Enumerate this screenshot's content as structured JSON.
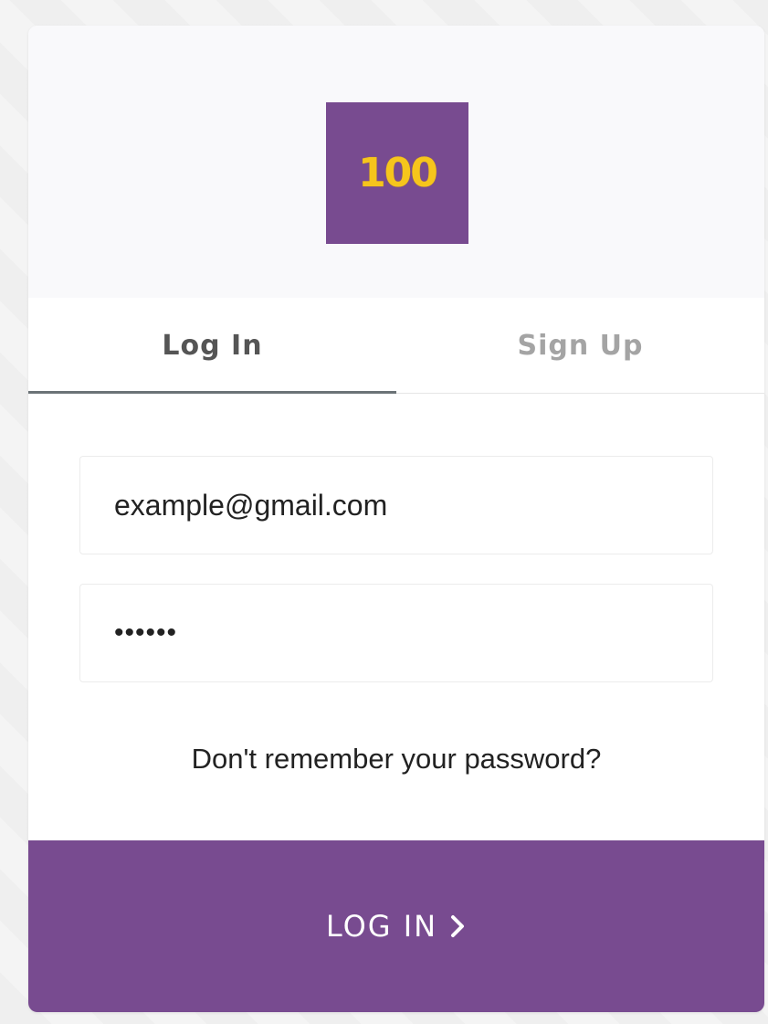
{
  "logo": {
    "text": "100",
    "background_color": "#784b90",
    "text_color": "#f6c51c"
  },
  "tabs": [
    {
      "label": "Log In",
      "active": true
    },
    {
      "label": "Sign Up",
      "active": false
    }
  ],
  "form": {
    "email_value": "example@gmail.com",
    "password_value": "••••••",
    "forgot_label": "Don't remember your password?"
  },
  "submit": {
    "label": "LOG IN",
    "icon": "chevron-right-icon",
    "background_color": "#784b90"
  }
}
